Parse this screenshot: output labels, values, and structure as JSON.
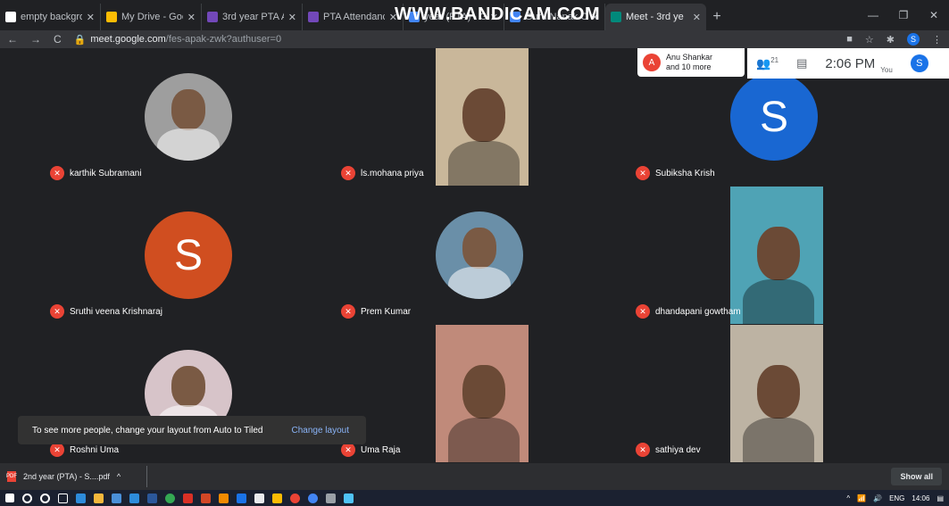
{
  "browser": {
    "tabs": [
      {
        "title": "empty backgroun",
        "color": "#ffffff",
        "active": false
      },
      {
        "title": "My Drive - Google",
        "color": "#fbbc04",
        "active": false
      },
      {
        "title": "3rd year PTA Atte",
        "color": "#7248b9",
        "active": false
      },
      {
        "title": "PTA Attendance F",
        "color": "#7248b9",
        "active": false
      },
      {
        "title": "year (PTA) - G",
        "color": "#4285f4",
        "active": false
      },
      {
        "title": "Guru Nanak Colle",
        "color": "#4285f4",
        "active": false
      },
      {
        "title": "Meet - 3rd ye",
        "color": "#00897b",
        "active": true
      }
    ],
    "watermark": "WWW.BANDICAM.COM",
    "url_host": "meet.google.com",
    "url_path": "/fes-apak-zwk?authuser=0",
    "profile_letter": "S"
  },
  "meet": {
    "join_chip": {
      "letter": "A",
      "line1": "Anu Shankar",
      "line2": "and 10 more"
    },
    "people_count": "21",
    "time": "2:06 PM",
    "self_label": "You",
    "self_letter": "S",
    "participants": [
      {
        "name": "karthik Subramani",
        "kind": "photo",
        "color": "#9e9e9e"
      },
      {
        "name": "ls.mohana priya",
        "kind": "video",
        "color": "#c9b79a"
      },
      {
        "name": "Subiksha Krish",
        "kind": "letter",
        "letter": "S",
        "color": "#1967d2"
      },
      {
        "name": "Sruthi veena Krishnaraj",
        "kind": "letter",
        "letter": "S",
        "color": "#d04e20"
      },
      {
        "name": "Prem Kumar",
        "kind": "photo",
        "color": "#6a8fa8"
      },
      {
        "name": "dhandapani gowtham",
        "kind": "video",
        "color": "#4fa3b5"
      },
      {
        "name": "Roshni Uma",
        "kind": "photo",
        "color": "#d7c4c9"
      },
      {
        "name": "Uma Raja",
        "kind": "video",
        "color": "#c08a7a"
      },
      {
        "name": "sathiya dev",
        "kind": "video",
        "color": "#bdb3a3"
      }
    ],
    "toast": {
      "message": "To see more people, change your layout from Auto to Tiled",
      "action": "Change layout"
    }
  },
  "downloads": {
    "file": "2nd year (PTA) - S....pdf",
    "show_all": "Show all"
  },
  "taskbar": {
    "lang": "ENG",
    "clock": "14:06"
  },
  "colors": {
    "mic_off": "#ea4335",
    "accent": "#1a73e8"
  }
}
